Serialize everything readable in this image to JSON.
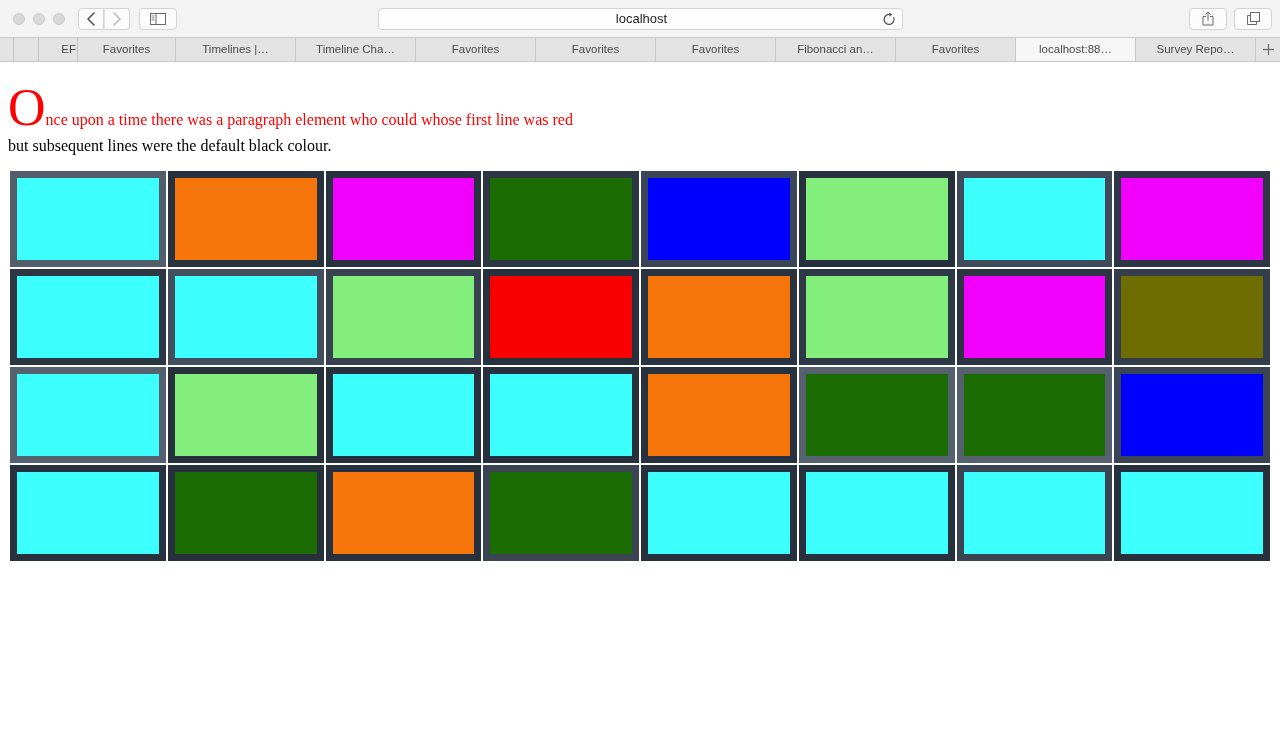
{
  "toolbar": {
    "back": {
      "disabled": false
    },
    "forward": {
      "disabled": true
    },
    "address": "localhost"
  },
  "tabs": [
    {
      "label": "EF",
      "selected": false
    },
    {
      "label": "Favorites",
      "selected": false
    },
    {
      "label": "Timelines |…",
      "selected": false
    },
    {
      "label": "Timeline Cha…",
      "selected": false
    },
    {
      "label": "Favorites",
      "selected": false
    },
    {
      "label": "Favorites",
      "selected": false
    },
    {
      "label": "Favorites",
      "selected": false
    },
    {
      "label": "Fibonacci an…",
      "selected": false
    },
    {
      "label": "Favorites",
      "selected": false
    },
    {
      "label": "localhost:88…",
      "selected": true
    },
    {
      "label": "Survey Repo…",
      "selected": false
    }
  ],
  "paragraph": {
    "lines": [
      "Once upon a time there was a paragraph element who could whose first line was red",
      "but subsequent lines were the default black colour."
    ]
  },
  "grid": {
    "rows": [
      {
        "tiles": [
          {
            "color": "#3dfffe",
            "frame": {
              "color": "#535e6d"
            }
          },
          {
            "color": "#f7760b",
            "frame": {
              "color": "#28323f"
            }
          },
          {
            "color": "#f200fe",
            "frame": {
              "color": "#28323f"
            }
          },
          {
            "color": "#1b6c02",
            "frame": {
              "color": "#2c3644"
            }
          },
          {
            "color": "#0000fe",
            "frame": {
              "color": "#3a4555"
            }
          },
          {
            "color": "#84ee7d",
            "frame": {
              "color": "#27313e"
            }
          },
          {
            "color": "#3dfffe",
            "frame": {
              "color": "#3f4a5a"
            }
          },
          {
            "color": "#f200fe",
            "frame": {
              "color": "#2c3644"
            }
          }
        ]
      },
      {
        "tiles": [
          {
            "color": "#3dfffe",
            "frame": {
              "color": "#2d3744"
            }
          },
          {
            "color": "#3dfffe",
            "frame": {
              "color": "#434f5e"
            }
          },
          {
            "color": "#84ee7d",
            "frame": {
              "color": "#37414f"
            }
          },
          {
            "color": "#f60000",
            "frame": {
              "color": "#28323f"
            }
          },
          {
            "color": "#f7760b",
            "frame": {
              "color": "#2a3441"
            }
          },
          {
            "color": "#84ee7d",
            "frame": {
              "color": "#2f3946"
            }
          },
          {
            "color": "#f200fe",
            "frame": {
              "color": "#2b3542"
            }
          },
          {
            "color": "#6d6d02",
            "frame": {
              "color": "#333d4b"
            }
          }
        ]
      },
      {
        "tiles": [
          {
            "color": "#3dfffe",
            "frame": {
              "color": "#56616f"
            }
          },
          {
            "color": "#84ee7d",
            "frame": {
              "color": "#27313e"
            }
          },
          {
            "color": "#3dfffe",
            "frame": {
              "color": "#27313e"
            }
          },
          {
            "color": "#3dfffe",
            "frame": {
              "color": "#27313e"
            }
          },
          {
            "color": "#f7760b",
            "frame": {
              "color": "#28323f"
            }
          },
          {
            "color": "#1b6c02",
            "frame": {
              "color": "#56616f"
            }
          },
          {
            "color": "#1b6c02",
            "frame": {
              "color": "#56616f"
            }
          },
          {
            "color": "#0000fe",
            "frame": {
              "color": "#3a4453"
            }
          }
        ]
      },
      {
        "tiles": [
          {
            "color": "#3dfffe",
            "frame": {
              "color": "#28323f"
            }
          },
          {
            "color": "#1b6c02",
            "frame": {
              "color": "#27313e"
            }
          },
          {
            "color": "#f7760b",
            "frame": {
              "color": "#27313e"
            }
          },
          {
            "color": "#1b6c02",
            "frame": {
              "color": "#3a4453"
            }
          },
          {
            "color": "#3dfffe",
            "frame": {
              "color": "#27313e"
            }
          },
          {
            "color": "#3dfffe",
            "frame": {
              "color": "#27313e"
            }
          },
          {
            "color": "#3dfffe",
            "frame": {
              "color": "#3a4453"
            }
          },
          {
            "color": "#3dfffe",
            "frame": {
              "color": "#27313e"
            }
          }
        ]
      }
    ]
  }
}
